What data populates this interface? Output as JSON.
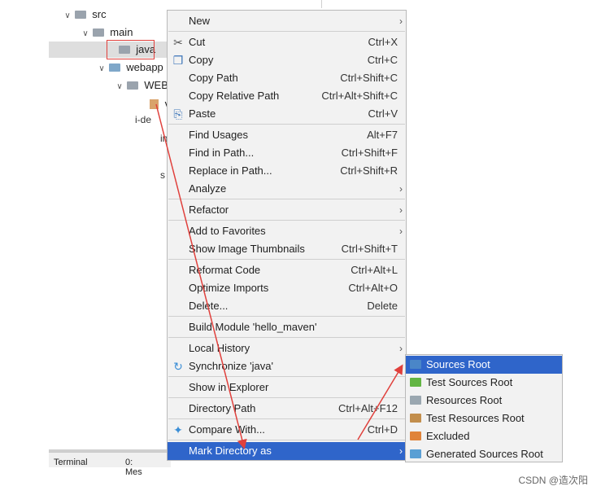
{
  "tree": {
    "src": "src",
    "main": "main",
    "java": "java",
    "webapp": "webapp",
    "web_inf": "WEB",
    "snip_v": "v",
    "snip_inde": "i‐de",
    "snip_in": "in",
    "snip_s": "s"
  },
  "bottom_bar": {
    "terminal": "Terminal",
    "messages": "0: Mes"
  },
  "menu": {
    "items": [
      {
        "label": "New",
        "shortcut": "",
        "submenu": true
      },
      {
        "label": "Cut",
        "shortcut": "Ctrl+X",
        "icon": "scissors-icon"
      },
      {
        "label": "Copy",
        "shortcut": "Ctrl+C",
        "icon": "copy-icon"
      },
      {
        "label": "Copy Path",
        "shortcut": "Ctrl+Shift+C"
      },
      {
        "label": "Copy Relative Path",
        "shortcut": "Ctrl+Alt+Shift+C"
      },
      {
        "label": "Paste",
        "shortcut": "Ctrl+V",
        "icon": "paste-icon"
      },
      {
        "label": "Find Usages",
        "shortcut": "Alt+F7"
      },
      {
        "label": "Find in Path...",
        "shortcut": "Ctrl+Shift+F"
      },
      {
        "label": "Replace in Path...",
        "shortcut": "Ctrl+Shift+R"
      },
      {
        "label": "Analyze",
        "shortcut": "",
        "submenu": true
      },
      {
        "label": "Refactor",
        "shortcut": "",
        "submenu": true
      },
      {
        "label": "Add to Favorites",
        "shortcut": "",
        "submenu": true
      },
      {
        "label": "Show Image Thumbnails",
        "shortcut": "Ctrl+Shift+T"
      },
      {
        "label": "Reformat Code",
        "shortcut": "Ctrl+Alt+L"
      },
      {
        "label": "Optimize Imports",
        "shortcut": "Ctrl+Alt+O"
      },
      {
        "label": "Delete...",
        "shortcut": "Delete"
      },
      {
        "label": "Build Module 'hello_maven'",
        "shortcut": ""
      },
      {
        "label": "Local History",
        "shortcut": "",
        "submenu": true
      },
      {
        "label": "Synchronize 'java'",
        "shortcut": "",
        "icon": "sync-icon"
      },
      {
        "label": "Show in Explorer",
        "shortcut": ""
      },
      {
        "label": "Directory Path",
        "shortcut": "Ctrl+Alt+F12"
      },
      {
        "label": "Compare With...",
        "shortcut": "Ctrl+D",
        "icon": "compare-icon"
      },
      {
        "label": "Mark Directory as",
        "shortcut": "",
        "submenu": true,
        "active": true
      }
    ]
  },
  "submenu": {
    "items": [
      {
        "label": "Sources Root",
        "color": "#4a86c8",
        "active": true
      },
      {
        "label": "Test Sources Root",
        "color": "#62b543"
      },
      {
        "label": "Resources Root",
        "color": "#9aa7b0"
      },
      {
        "label": "Test Resources Root",
        "color": "#c28e4c"
      },
      {
        "label": "Excluded",
        "color": "#e0833a"
      },
      {
        "label": "Generated Sources Root",
        "color": "#5a9fd4"
      }
    ]
  },
  "colors": {
    "accent": "#2f65ca",
    "annotation_red": "#e0403c"
  },
  "watermark": "CSDN @造次阳"
}
